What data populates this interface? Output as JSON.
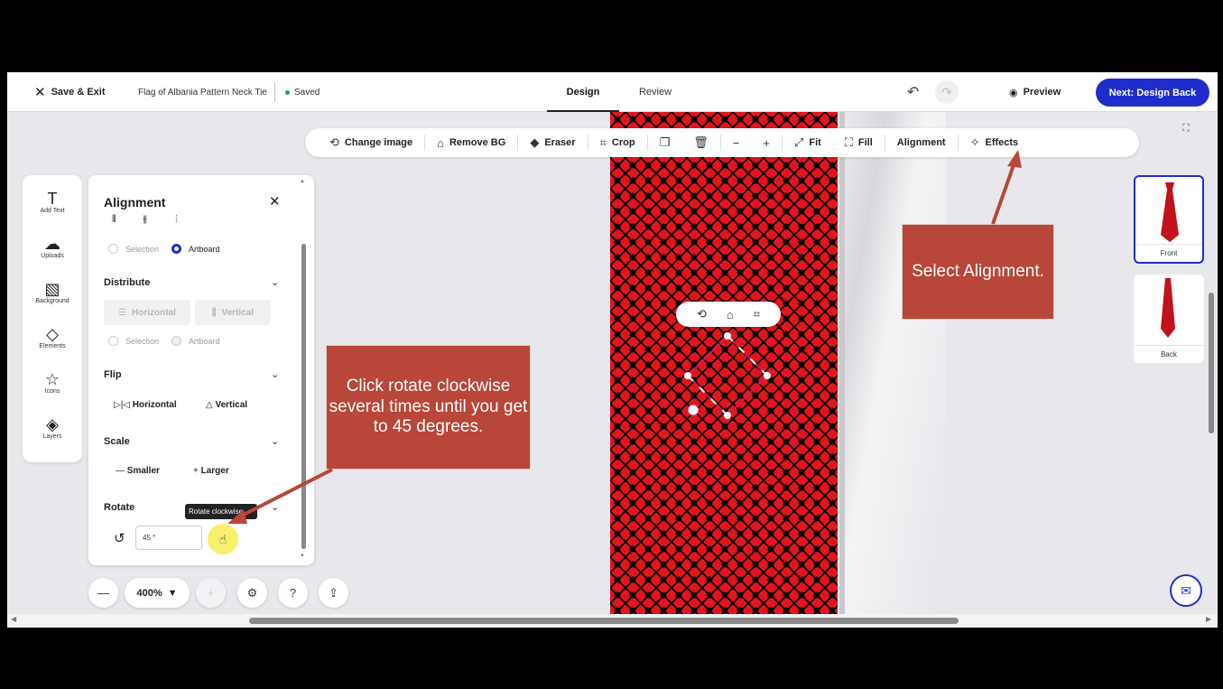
{
  "topbar": {
    "save_exit": "Save & Exit",
    "doc_title": "Flag of Albania Pattern Neck Tie",
    "saved": "Saved",
    "tabs": [
      {
        "label": "Design",
        "active": true
      },
      {
        "label": "Review",
        "active": false
      }
    ],
    "preview": "Preview",
    "next": "Next: Design Back"
  },
  "toolbar": {
    "change_image": "Change image",
    "remove_bg": "Remove BG",
    "eraser": "Eraser",
    "crop": "Crop",
    "minus": "−",
    "plus": "+",
    "fit": "Fit",
    "fill": "Fill",
    "alignment": "Alignment",
    "effects": "Effects"
  },
  "rail": [
    {
      "label": "Add Text",
      "icon": "text-icon",
      "glyph": "T"
    },
    {
      "label": "Uploads",
      "icon": "upload-cloud-icon",
      "glyph": "☁"
    },
    {
      "label": "Background",
      "icon": "background-icon",
      "glyph": "▧"
    },
    {
      "label": "Elements",
      "icon": "elements-icon",
      "glyph": "◇"
    },
    {
      "label": "Icons",
      "icon": "star-icon",
      "glyph": "☆"
    },
    {
      "label": "Layers",
      "icon": "layers-icon",
      "glyph": "◈"
    }
  ],
  "panel": {
    "title": "Alignment",
    "align_selection": "Selection",
    "align_artboard": "Artboard",
    "distribute": "Distribute",
    "dist_horizontal": "Horizontal",
    "dist_vertical": "Vertical",
    "dist_selection": "Selection",
    "dist_artboard": "Artboard",
    "flip": "Flip",
    "flip_horizontal": "Horizontal",
    "flip_vertical": "Vertical",
    "scale": "Scale",
    "smaller": "Smaller",
    "larger": "Larger",
    "rotate": "Rotate",
    "rotate_value": "45 °",
    "tooltip": "Rotate clockwise"
  },
  "zoom": {
    "level": "400%"
  },
  "callouts": {
    "rotate": "Click rotate clockwise several times until you get to 45 degrees.",
    "alignment": "Select Alignment."
  },
  "thumbs": [
    {
      "label": "Front",
      "selected": true
    },
    {
      "label": "Back",
      "selected": false
    }
  ],
  "colors": {
    "accent": "#1f2ecb",
    "tie_red": "#e4141b",
    "callout": "#b8463a",
    "saved_dot": "#2e9e4f"
  }
}
